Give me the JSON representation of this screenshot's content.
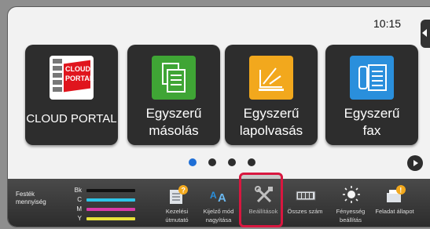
{
  "status": {
    "time": "10:15"
  },
  "tiles": [
    {
      "id": "cloud",
      "label": "CLOUD PORTAL",
      "icon": "cloud-portal-icon",
      "icon_text": [
        "CLOUD",
        "PORTAL"
      ]
    },
    {
      "id": "copy",
      "label": "Egyszerű másolás",
      "icon": "copy-icon",
      "color": "#3fa535"
    },
    {
      "id": "scan",
      "label": "Egyszerű lapolvasás",
      "icon": "scan-icon",
      "color": "#f2a81d"
    },
    {
      "id": "fax",
      "label": "Egyszerű fax",
      "icon": "fax-icon",
      "color": "#2a8fdc"
    }
  ],
  "pager": {
    "pages": 4,
    "active": 1
  },
  "taskbar": {
    "toner": {
      "title": "Festék mennyiség",
      "levels": [
        {
          "label": "Bk",
          "color": "#111111"
        },
        {
          "label": "C",
          "color": "#2ec4e8"
        },
        {
          "label": "M",
          "color": "#d93aa8"
        },
        {
          "label": "Y",
          "color": "#e8e23a"
        }
      ]
    },
    "buttons": [
      {
        "id": "manual",
        "label": "Kezelési útmutató",
        "icon": "manual-icon"
      },
      {
        "id": "zoom",
        "label": "Kijelző mód nagyítása",
        "icon": "zoom-text-icon"
      },
      {
        "id": "settings",
        "label": "Beállítások",
        "icon": "wrench-screwdriver-icon"
      },
      {
        "id": "count",
        "label": "Összes szám",
        "icon": "counter-icon"
      },
      {
        "id": "bright",
        "label": "Fényesség beállítás",
        "icon": "brightness-icon"
      },
      {
        "id": "job",
        "label": "Feladat állapot",
        "icon": "job-status-icon"
      }
    ]
  },
  "colors": {
    "highlight": "#d8173f",
    "accent": "#1f6fd6"
  }
}
